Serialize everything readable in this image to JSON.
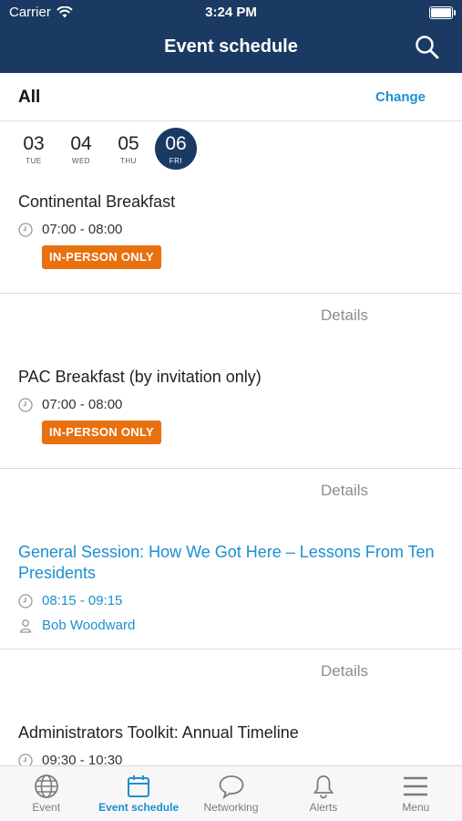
{
  "status_bar": {
    "carrier": "Carrier",
    "time": "3:24 PM"
  },
  "header": {
    "title": "Event schedule"
  },
  "filter": {
    "label": "All",
    "change_label": "Change"
  },
  "days": [
    {
      "num": "03",
      "dow": "TUE",
      "selected": false
    },
    {
      "num": "04",
      "dow": "WED",
      "selected": false
    },
    {
      "num": "05",
      "dow": "THU",
      "selected": false
    },
    {
      "num": "06",
      "dow": "FRI",
      "selected": true
    }
  ],
  "events": [
    {
      "title": "Continental Breakfast",
      "time": "07:00 - 08:00",
      "badge": "IN-PERSON ONLY",
      "details_label": "Details"
    },
    {
      "title": "PAC Breakfast (by invitation only)",
      "time": "07:00 - 08:00",
      "badge": "IN-PERSON ONLY",
      "details_label": "Details"
    },
    {
      "title": "General Session: How We Got Here – Lessons From Ten Presidents",
      "time": "08:15 - 09:15",
      "speaker": "Bob Woodward",
      "details_label": "Details"
    },
    {
      "title": "Administrators Toolkit: Annual Timeline",
      "time": "09:30 - 10:30"
    }
  ],
  "tabs": [
    {
      "label": "Event",
      "icon": "globe-icon",
      "active": false
    },
    {
      "label": "Event schedule",
      "icon": "calendar-icon",
      "active": true
    },
    {
      "label": "Networking",
      "icon": "chat-bubble-icon",
      "active": false
    },
    {
      "label": "Alerts",
      "icon": "bell-icon",
      "active": false
    },
    {
      "label": "Menu",
      "icon": "hamburger-menu-icon",
      "active": false
    }
  ],
  "colors": {
    "header_bg": "#1b3a63",
    "accent": "#1d8fd1",
    "badge": "#e8700f"
  }
}
